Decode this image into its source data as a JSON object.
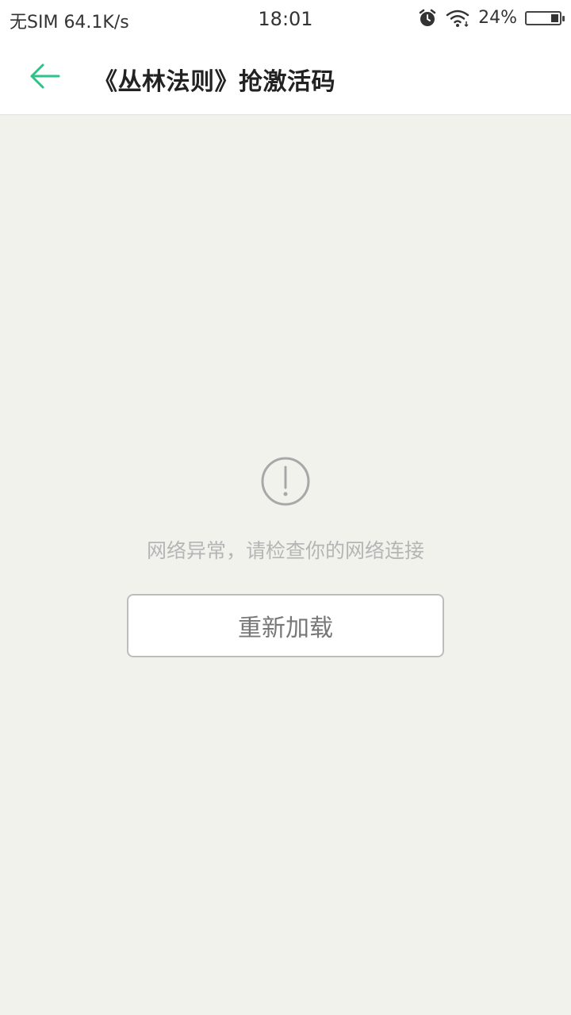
{
  "status_bar": {
    "carrier": "无SIM",
    "net_speed": "64.1K/s",
    "time": "18:01",
    "alarm_icon": "alarm-clock-icon",
    "wifi_icon": "wifi-icon",
    "battery_percent_text": "24%",
    "battery_level": 0.24
  },
  "header": {
    "back_icon": "arrow-left-icon",
    "title": "《丛林法则》抢激活码",
    "accent_color": "#2ec28a"
  },
  "error_state": {
    "icon": "exclamation-circle-icon",
    "message": "网络异常，请检查你的网络连接",
    "reload_label": "重新加载"
  }
}
